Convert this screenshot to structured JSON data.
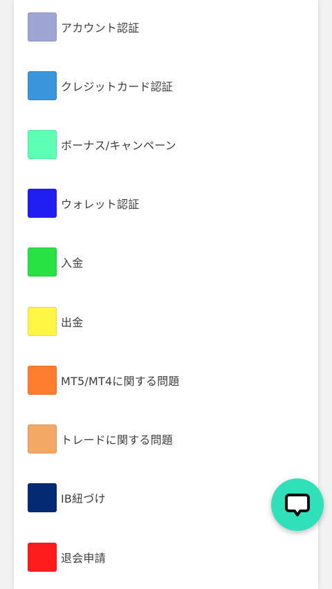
{
  "categories": [
    {
      "label": "アカウント認証",
      "color": "#9fa5d3"
    },
    {
      "label": "クレジットカード認証",
      "color": "#3a95dd"
    },
    {
      "label": "ボーナス/キャンペーン",
      "color": "#5cffb3"
    },
    {
      "label": "ウォレット認証",
      "color": "#1f1ff2"
    },
    {
      "label": "入金",
      "color": "#27e242"
    },
    {
      "label": "出金",
      "color": "#fff542"
    },
    {
      "label": "MT5/MT4に関する問題",
      "color": "#ff7d2e"
    },
    {
      "label": "トレードに関する問題",
      "color": "#f3a866"
    },
    {
      "label": "IB紐づけ",
      "color": "#032a73"
    },
    {
      "label": "退会申請",
      "color": "#ff1c1c"
    }
  ],
  "chat_button": {
    "icon": "chat-bubble-icon",
    "color": "#2fe0b8"
  }
}
